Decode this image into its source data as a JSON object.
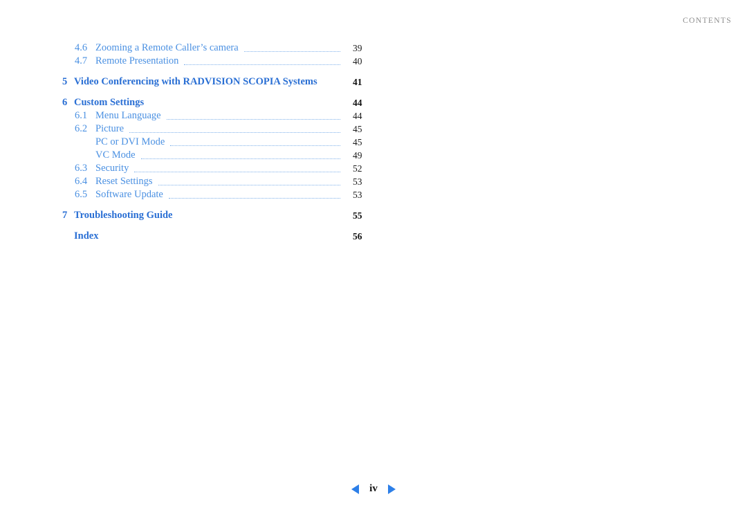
{
  "running_head": "CONTENTS",
  "colors": {
    "section_blue": "#2a6fd4",
    "entry_blue": "#4a90e2",
    "leader_blue": "#7eb0ea",
    "arrow_blue": "#2d7fe8",
    "page_number": "#1b1b1b",
    "running_head_grey": "#8d8d8d"
  },
  "toc": {
    "entries": [
      {
        "level": 2,
        "number": "4.6",
        "title": "Zooming a Remote Caller’s camera",
        "page": "39",
        "leader": true,
        "gap_before": false
      },
      {
        "level": 2,
        "number": "4.7",
        "title": "Remote Presentation",
        "page": "40",
        "leader": true,
        "gap_before": false
      },
      {
        "level": 1,
        "number": "5",
        "title": "Video Conferencing with RADVISION SCOPIA Systems",
        "page": "41",
        "leader": false,
        "gap_before": true
      },
      {
        "level": 1,
        "number": "6",
        "title": "Custom Settings",
        "page": "44",
        "leader": false,
        "gap_before": true
      },
      {
        "level": 2,
        "number": "6.1",
        "title": "Menu Language",
        "page": "44",
        "leader": true,
        "gap_before": false
      },
      {
        "level": 2,
        "number": "6.2",
        "title": "Picture",
        "page": "45",
        "leader": true,
        "gap_before": false
      },
      {
        "level": 3,
        "number": "",
        "title": "PC or DVI Mode",
        "page": "45",
        "leader": true,
        "gap_before": false
      },
      {
        "level": 3,
        "number": "",
        "title": "VC Mode",
        "page": "49",
        "leader": true,
        "gap_before": false
      },
      {
        "level": 2,
        "number": "6.3",
        "title": "Security",
        "page": "52",
        "leader": true,
        "gap_before": false
      },
      {
        "level": 2,
        "number": "6.4",
        "title": "Reset Settings",
        "page": "53",
        "leader": true,
        "gap_before": false
      },
      {
        "level": 2,
        "number": "6.5",
        "title": "Software Update",
        "page": "53",
        "leader": true,
        "gap_before": false
      },
      {
        "level": 1,
        "number": "7",
        "title": "Troubleshooting Guide",
        "page": "55",
        "leader": false,
        "gap_before": true
      },
      {
        "level": 1,
        "number": "",
        "title": "Index",
        "page": "56",
        "leader": false,
        "gap_before": true
      }
    ]
  },
  "footer": {
    "prev_icon": "triangle-left-icon",
    "next_icon": "triangle-right-icon",
    "folio": "iv"
  }
}
